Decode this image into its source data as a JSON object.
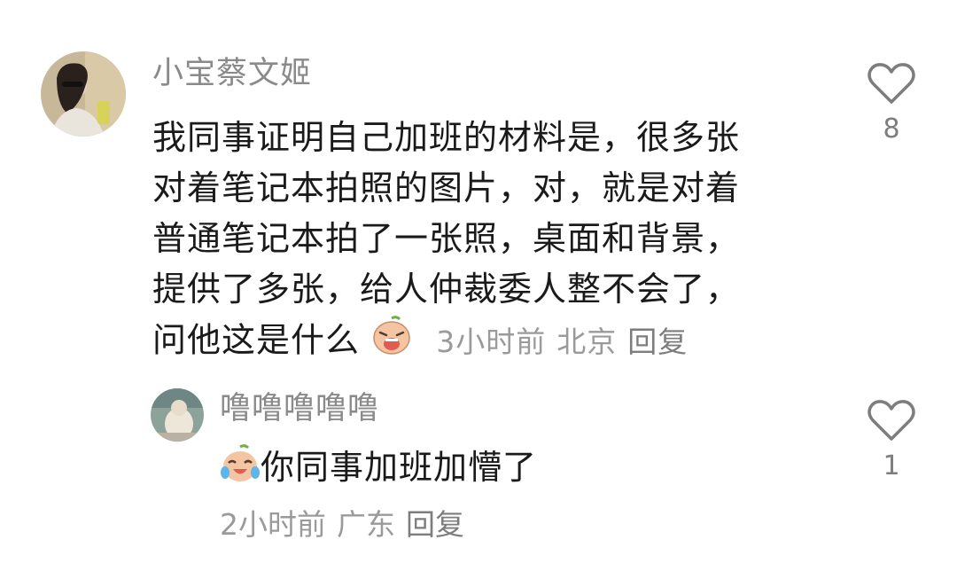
{
  "comments": [
    {
      "username": "小宝蔡文姬",
      "lines": [
        "我同事证明自己加班的材料是，很多张",
        "对着笔记本拍照的图片，对，就是对着",
        "普通笔记本拍了一张照，桌面和背景，",
        "提供了多张，给人仲裁委人整不会了，",
        "问他这是什么"
      ],
      "emoji": "crying-face-emoji",
      "time": "3小时前",
      "location": "北京",
      "reply_label": "回复",
      "like_count": "8"
    },
    {
      "username": "噜噜噜噜噜",
      "emoji": "laughing-tears-emoji",
      "text": "你同事加班加懵了",
      "time": "2小时前",
      "location": "广东",
      "reply_label": "回复",
      "like_count": "1"
    }
  ]
}
